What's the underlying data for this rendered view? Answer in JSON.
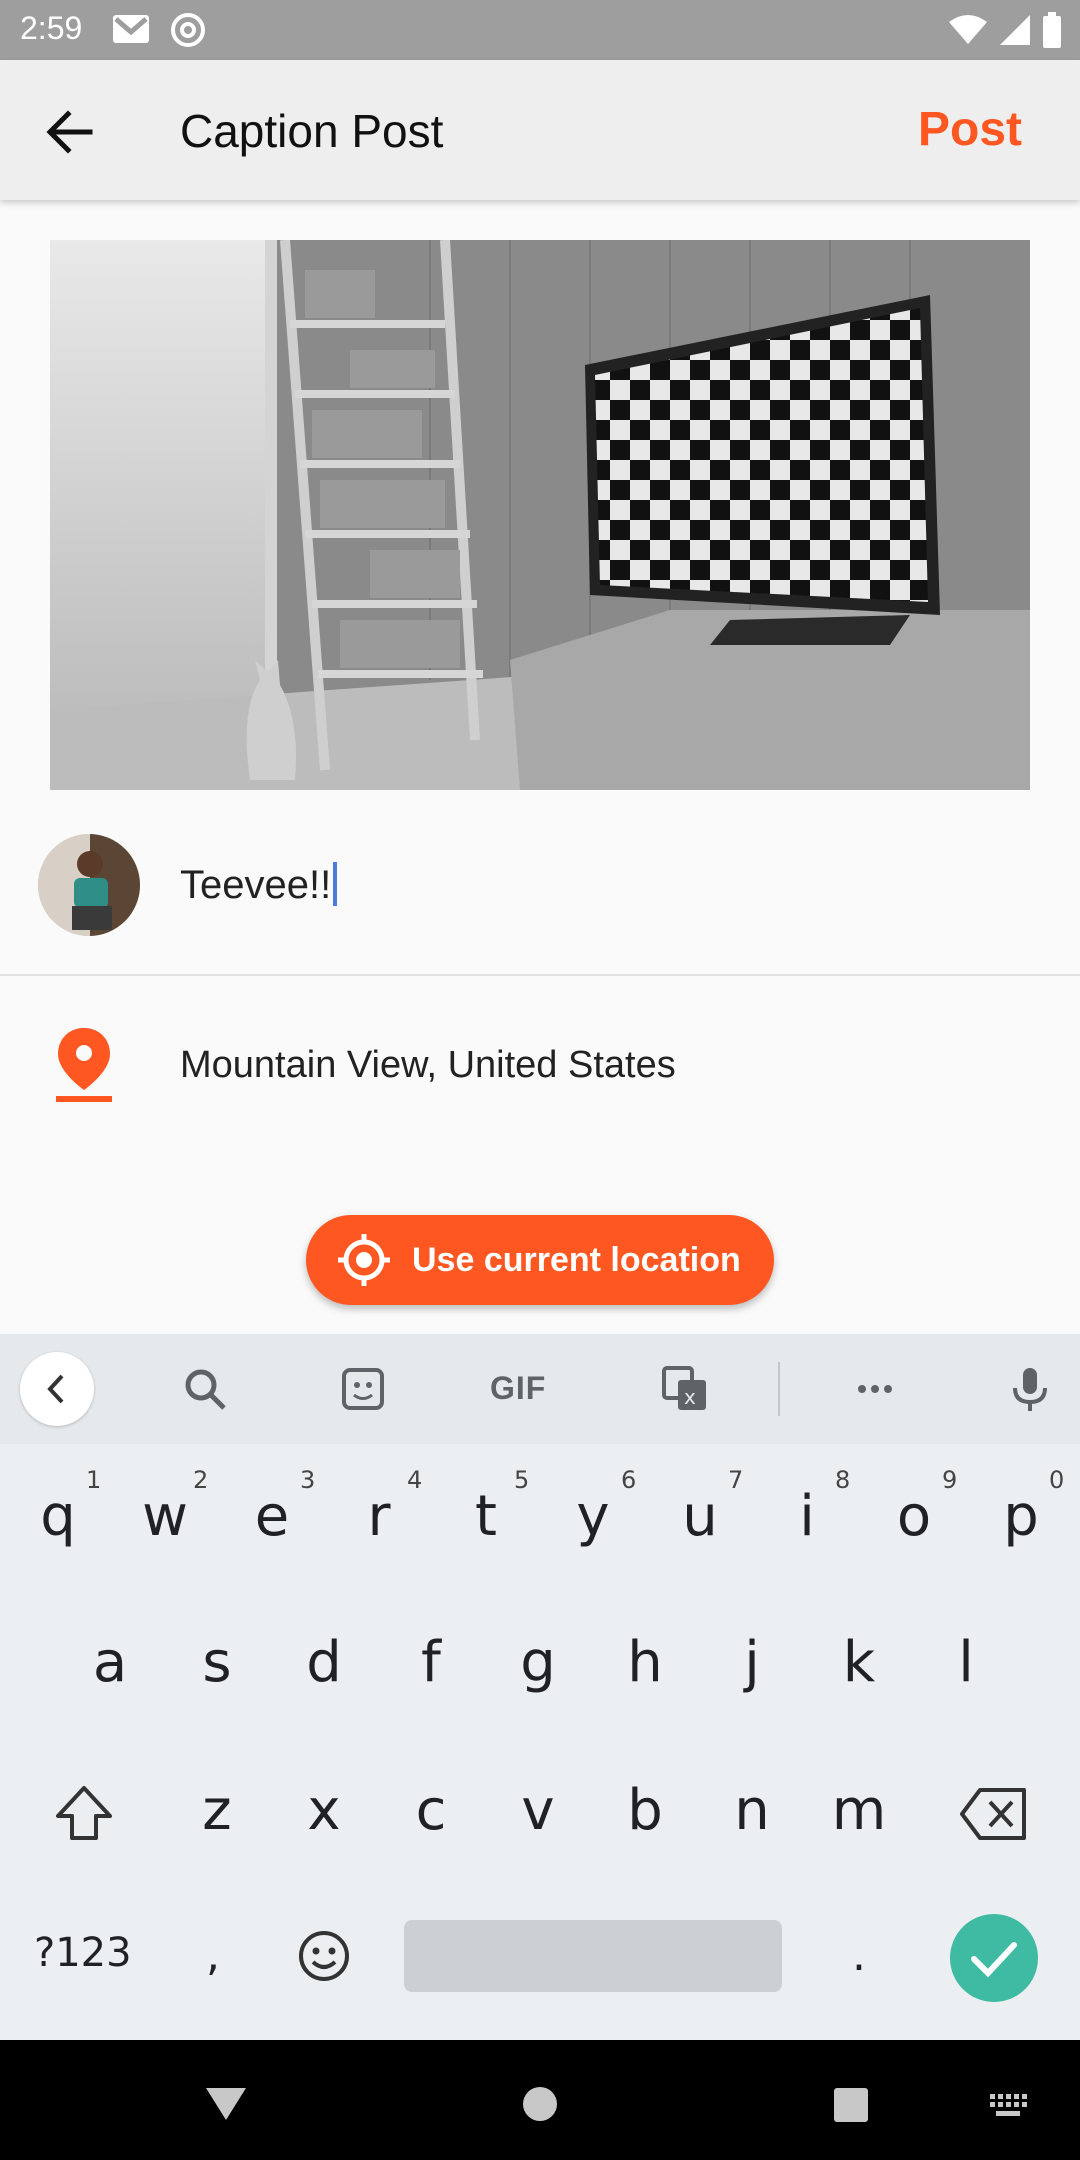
{
  "status_bar": {
    "time": "2:59",
    "icons_left": [
      "gmail-icon",
      "at-sign-icon"
    ],
    "icons_right": [
      "wifi-icon",
      "signal-icon",
      "battery-icon"
    ]
  },
  "app_bar": {
    "title": "Caption Post",
    "post_label": "Post",
    "accent_color": "#ff5722"
  },
  "caption": {
    "text": "Teevee!!"
  },
  "location": {
    "text": "Mountain View, United States",
    "use_current_label": "Use current location"
  },
  "keyboard": {
    "toolbar": {
      "gif_label": "GIF",
      "icons": [
        "chevron-left-icon",
        "search-icon",
        "sticker-icon",
        "gif-icon",
        "translate-icon",
        "more-icon",
        "mic-icon"
      ]
    },
    "row1": [
      {
        "key": "q",
        "hint": "1"
      },
      {
        "key": "w",
        "hint": "2"
      },
      {
        "key": "e",
        "hint": "3"
      },
      {
        "key": "r",
        "hint": "4"
      },
      {
        "key": "t",
        "hint": "5"
      },
      {
        "key": "y",
        "hint": "6"
      },
      {
        "key": "u",
        "hint": "7"
      },
      {
        "key": "i",
        "hint": "8"
      },
      {
        "key": "o",
        "hint": "9"
      },
      {
        "key": "p",
        "hint": "0"
      }
    ],
    "row2": [
      "a",
      "s",
      "d",
      "f",
      "g",
      "h",
      "j",
      "k",
      "l"
    ],
    "row3": [
      "z",
      "x",
      "c",
      "v",
      "b",
      "n",
      "m"
    ],
    "symbols_label": "?123",
    "comma_label": ",",
    "period_label": ".",
    "enter_color": "#3ebba2"
  }
}
